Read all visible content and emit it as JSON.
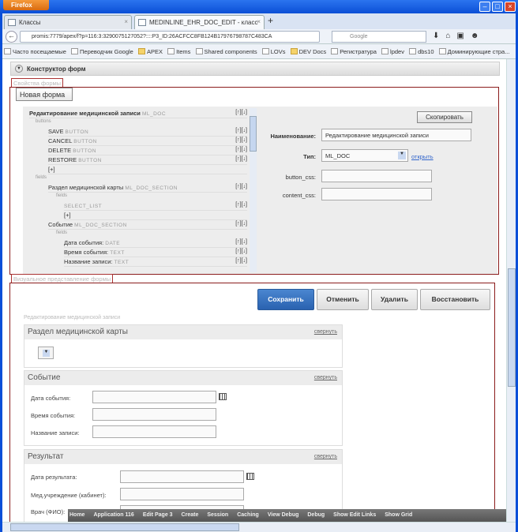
{
  "browser": {
    "app_button": "Firefox",
    "tabs": [
      {
        "label": "Классы"
      },
      {
        "label": "MEDINLINE_EHR_DOC_EDIT - класс"
      }
    ],
    "new_tab": "+",
    "url": "promis:7779/apex/f?p=116:3:3290075127052?::::P3_ID:26ACFCC8FB124B17976798787C483CA",
    "search_placeholder": "Google",
    "bookmarks": [
      "Часто посещаемые",
      "Переводчик Google",
      "APEX",
      "Items",
      "Shared components",
      "LOVs",
      "DEV Docs",
      "Регистратура",
      "lpdev",
      "dbs10",
      "Доминирующие стра..."
    ]
  },
  "constructor": {
    "title": "Конструктор форм",
    "props_label": "Свойства формы",
    "new_form": "Новая форма",
    "tree": {
      "root": "Редактирование медицинской записи",
      "root_type": "ML_DOC",
      "buttons_label": "buttons",
      "buttons": [
        {
          "name": "SAVE",
          "type": "BUTTON"
        },
        {
          "name": "CANCEL",
          "type": "BUTTON"
        },
        {
          "name": "DELETE",
          "type": "BUTTON"
        },
        {
          "name": "RESTORE",
          "type": "BUTTON"
        }
      ],
      "add": "[+]",
      "fields_label": "fields",
      "sections": [
        {
          "name": "Раздел медицинской карты",
          "type": "ML_DOC_SECTION",
          "fields": [
            {
              "name": "",
              "type": "SELECT_LIST"
            }
          ]
        },
        {
          "name": "Событие",
          "type": "ML_DOC_SECTION",
          "fields": [
            {
              "name": "Дата события:",
              "type": "DATE"
            },
            {
              "name": "Время события:",
              "type": "TEXT"
            },
            {
              "name": "Название записи:",
              "type": "TEXT"
            }
          ]
        }
      ],
      "arrows": "[↑][↓]"
    },
    "copy_button": "Скопировать",
    "name_label": "Наименование:",
    "name_value": "Редактирование медицинской записи",
    "type_label": "Тип:",
    "type_value": "ML_DOC",
    "open_link": "открыть",
    "button_css_label": "button_css:",
    "content_css_label": "content_css:"
  },
  "preview": {
    "label": "Визуальное представление формы",
    "buttons": {
      "save": "Сохранить",
      "cancel": "Отменить",
      "delete": "Удалить",
      "restore": "Восстановить"
    },
    "form_title": "Редактирование медицинской записи",
    "collapse": "свернуть",
    "sections": [
      {
        "title": "Раздел медицинской карты"
      },
      {
        "title": "Событие",
        "fields": [
          "Дата события:",
          "Время события:",
          "Название записи:"
        ]
      },
      {
        "title": "Результат",
        "fields": [
          "Дата результата:",
          "Мед.учреждение (кабинет):",
          "Врач (ФИО):"
        ]
      }
    ]
  },
  "devbar": [
    "Home",
    "Application 116",
    "Edit Page 3",
    "Create",
    "Session",
    "Caching",
    "View Debug",
    "Debug",
    "Show Edit Links",
    "Show Grid"
  ]
}
